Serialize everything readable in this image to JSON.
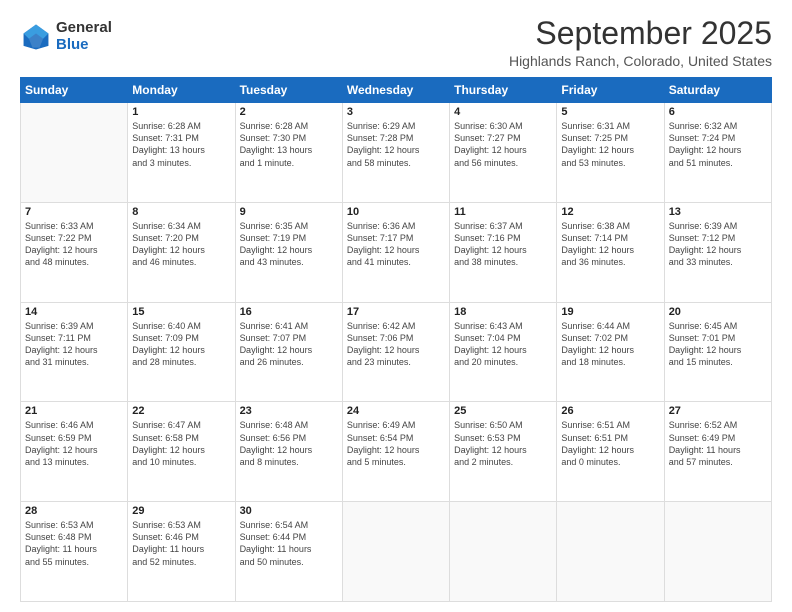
{
  "logo": {
    "general": "General",
    "blue": "Blue"
  },
  "title": "September 2025",
  "subtitle": "Highlands Ranch, Colorado, United States",
  "days_of_week": [
    "Sunday",
    "Monday",
    "Tuesday",
    "Wednesday",
    "Thursday",
    "Friday",
    "Saturday"
  ],
  "weeks": [
    [
      {
        "day": "",
        "info": ""
      },
      {
        "day": "1",
        "info": "Sunrise: 6:28 AM\nSunset: 7:31 PM\nDaylight: 13 hours\nand 3 minutes."
      },
      {
        "day": "2",
        "info": "Sunrise: 6:28 AM\nSunset: 7:30 PM\nDaylight: 13 hours\nand 1 minute."
      },
      {
        "day": "3",
        "info": "Sunrise: 6:29 AM\nSunset: 7:28 PM\nDaylight: 12 hours\nand 58 minutes."
      },
      {
        "day": "4",
        "info": "Sunrise: 6:30 AM\nSunset: 7:27 PM\nDaylight: 12 hours\nand 56 minutes."
      },
      {
        "day": "5",
        "info": "Sunrise: 6:31 AM\nSunset: 7:25 PM\nDaylight: 12 hours\nand 53 minutes."
      },
      {
        "day": "6",
        "info": "Sunrise: 6:32 AM\nSunset: 7:24 PM\nDaylight: 12 hours\nand 51 minutes."
      }
    ],
    [
      {
        "day": "7",
        "info": "Sunrise: 6:33 AM\nSunset: 7:22 PM\nDaylight: 12 hours\nand 48 minutes."
      },
      {
        "day": "8",
        "info": "Sunrise: 6:34 AM\nSunset: 7:20 PM\nDaylight: 12 hours\nand 46 minutes."
      },
      {
        "day": "9",
        "info": "Sunrise: 6:35 AM\nSunset: 7:19 PM\nDaylight: 12 hours\nand 43 minutes."
      },
      {
        "day": "10",
        "info": "Sunrise: 6:36 AM\nSunset: 7:17 PM\nDaylight: 12 hours\nand 41 minutes."
      },
      {
        "day": "11",
        "info": "Sunrise: 6:37 AM\nSunset: 7:16 PM\nDaylight: 12 hours\nand 38 minutes."
      },
      {
        "day": "12",
        "info": "Sunrise: 6:38 AM\nSunset: 7:14 PM\nDaylight: 12 hours\nand 36 minutes."
      },
      {
        "day": "13",
        "info": "Sunrise: 6:39 AM\nSunset: 7:12 PM\nDaylight: 12 hours\nand 33 minutes."
      }
    ],
    [
      {
        "day": "14",
        "info": "Sunrise: 6:39 AM\nSunset: 7:11 PM\nDaylight: 12 hours\nand 31 minutes."
      },
      {
        "day": "15",
        "info": "Sunrise: 6:40 AM\nSunset: 7:09 PM\nDaylight: 12 hours\nand 28 minutes."
      },
      {
        "day": "16",
        "info": "Sunrise: 6:41 AM\nSunset: 7:07 PM\nDaylight: 12 hours\nand 26 minutes."
      },
      {
        "day": "17",
        "info": "Sunrise: 6:42 AM\nSunset: 7:06 PM\nDaylight: 12 hours\nand 23 minutes."
      },
      {
        "day": "18",
        "info": "Sunrise: 6:43 AM\nSunset: 7:04 PM\nDaylight: 12 hours\nand 20 minutes."
      },
      {
        "day": "19",
        "info": "Sunrise: 6:44 AM\nSunset: 7:02 PM\nDaylight: 12 hours\nand 18 minutes."
      },
      {
        "day": "20",
        "info": "Sunrise: 6:45 AM\nSunset: 7:01 PM\nDaylight: 12 hours\nand 15 minutes."
      }
    ],
    [
      {
        "day": "21",
        "info": "Sunrise: 6:46 AM\nSunset: 6:59 PM\nDaylight: 12 hours\nand 13 minutes."
      },
      {
        "day": "22",
        "info": "Sunrise: 6:47 AM\nSunset: 6:58 PM\nDaylight: 12 hours\nand 10 minutes."
      },
      {
        "day": "23",
        "info": "Sunrise: 6:48 AM\nSunset: 6:56 PM\nDaylight: 12 hours\nand 8 minutes."
      },
      {
        "day": "24",
        "info": "Sunrise: 6:49 AM\nSunset: 6:54 PM\nDaylight: 12 hours\nand 5 minutes."
      },
      {
        "day": "25",
        "info": "Sunrise: 6:50 AM\nSunset: 6:53 PM\nDaylight: 12 hours\nand 2 minutes."
      },
      {
        "day": "26",
        "info": "Sunrise: 6:51 AM\nSunset: 6:51 PM\nDaylight: 12 hours\nand 0 minutes."
      },
      {
        "day": "27",
        "info": "Sunrise: 6:52 AM\nSunset: 6:49 PM\nDaylight: 11 hours\nand 57 minutes."
      }
    ],
    [
      {
        "day": "28",
        "info": "Sunrise: 6:53 AM\nSunset: 6:48 PM\nDaylight: 11 hours\nand 55 minutes."
      },
      {
        "day": "29",
        "info": "Sunrise: 6:53 AM\nSunset: 6:46 PM\nDaylight: 11 hours\nand 52 minutes."
      },
      {
        "day": "30",
        "info": "Sunrise: 6:54 AM\nSunset: 6:44 PM\nDaylight: 11 hours\nand 50 minutes."
      },
      {
        "day": "",
        "info": ""
      },
      {
        "day": "",
        "info": ""
      },
      {
        "day": "",
        "info": ""
      },
      {
        "day": "",
        "info": ""
      }
    ]
  ]
}
